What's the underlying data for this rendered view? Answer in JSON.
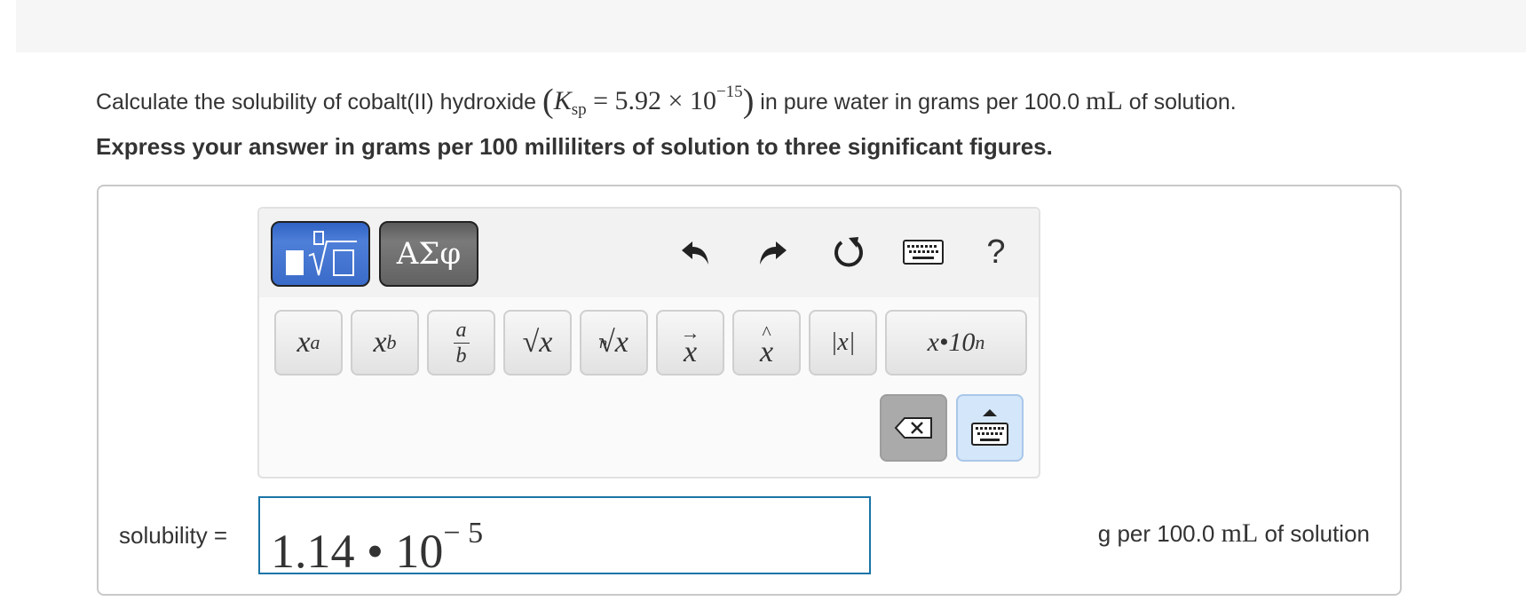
{
  "question": {
    "prefix": "Calculate the solubility of cobalt(II) hydroxide",
    "ksp_symbol": "K",
    "ksp_subscript": "sp",
    "ksp_value": "= 5.92 × 10",
    "ksp_exponent": "−15",
    "middle": "in pure water in grams per 100.0",
    "unit": "mL",
    "suffix": "of solution."
  },
  "instruction": "Express your answer in grams per 100 milliliters of solution to three significant figures.",
  "palette": {
    "symbols_label": "ΑΣφ",
    "help_label": "?",
    "templates": {
      "power_base": "x",
      "power_exp": "a",
      "sub_base": "x",
      "sub_index": "b",
      "frac_num": "a",
      "frac_den": "b",
      "sqrt": "√x",
      "nth_root_index": "n",
      "nth_root": "√x",
      "vector": "x",
      "hat": "x",
      "abs": "|x|",
      "sci": "x•10",
      "sci_exp": "n"
    }
  },
  "answer": {
    "label": "solubility =",
    "value": "1.14 • 10",
    "exponent": "− 5",
    "units_prefix": "g per 100.0",
    "units_unit": "mL",
    "units_suffix": "of solution"
  },
  "colors": {
    "templates_button": "#3a6bc9",
    "symbols_button": "#6a6a6a",
    "input_border": "#1a74a6",
    "keyboard_toggle": "#d4e6fa",
    "backspace": "#aaaaaa"
  },
  "icons": [
    "undo-icon",
    "redo-icon",
    "reset-icon",
    "keyboard-icon",
    "help-icon",
    "backspace-icon",
    "keyboard-toggle-icon"
  ]
}
